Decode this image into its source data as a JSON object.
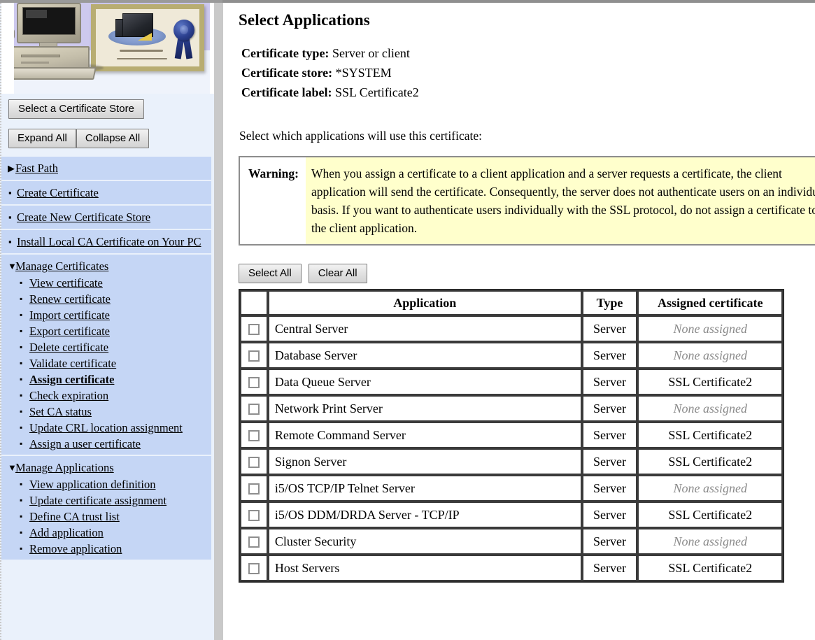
{
  "sidebar": {
    "banner_alt": "certificate-and-computer-banner",
    "store_button": "Select a Certificate Store",
    "expand_all": "Expand All",
    "collapse_all": "Collapse All",
    "nav": [
      {
        "label": "Fast Path",
        "marker": "▶",
        "bold": false,
        "children": []
      },
      {
        "label": "Create Certificate",
        "marker": "▪",
        "bold": false,
        "children": []
      },
      {
        "label": "Create New Certificate Store",
        "marker": "▪",
        "bold": false,
        "children": []
      },
      {
        "label": "Install Local CA Certificate on Your PC",
        "marker": "▪",
        "bold": false,
        "children": []
      },
      {
        "label": "Manage Certificates",
        "marker": "▼",
        "bold": false,
        "children": [
          {
            "label": "View certificate",
            "bold": false
          },
          {
            "label": "Renew certificate",
            "bold": false
          },
          {
            "label": "Import certificate",
            "bold": false
          },
          {
            "label": "Export certificate",
            "bold": false
          },
          {
            "label": "Delete certificate",
            "bold": false
          },
          {
            "label": "Validate certificate",
            "bold": false
          },
          {
            "label": "Assign certificate",
            "bold": true
          },
          {
            "label": "Check expiration",
            "bold": false
          },
          {
            "label": "Set CA status",
            "bold": false
          },
          {
            "label": "Update CRL location assignment",
            "bold": false
          },
          {
            "label": "Assign a user certificate",
            "bold": false
          }
        ]
      },
      {
        "label": "Manage Applications",
        "marker": "▼",
        "bold": false,
        "children": [
          {
            "label": "View application definition",
            "bold": false
          },
          {
            "label": "Update certificate assignment",
            "bold": false
          },
          {
            "label": "Define CA trust list",
            "bold": false
          },
          {
            "label": "Add application",
            "bold": false
          },
          {
            "label": "Remove application",
            "bold": false
          }
        ]
      }
    ]
  },
  "main": {
    "title": "Select Applications",
    "meta": [
      {
        "label": "Certificate type:",
        "value": "Server or client"
      },
      {
        "label": "Certificate store:",
        "value": "*SYSTEM"
      },
      {
        "label": "Certificate label:",
        "value": "SSL Certificate2"
      }
    ],
    "instruction": "Select which applications will use this certificate:",
    "warning": {
      "label": "Warning:",
      "text": "When you assign a certificate to a client application and a server requests a certificate, the client application will send the certificate. Consequently, the server does not authenticate users on an individual basis. If you want to authenticate users individually with the SSL protocol, do not assign a certificate to the client application.",
      "background": "#ffffcc"
    },
    "buttons": {
      "select_all": "Select All",
      "clear_all": "Clear All"
    },
    "table": {
      "headers": [
        "",
        "Application",
        "Type",
        "Assigned certificate"
      ],
      "rows": [
        {
          "checked": false,
          "application": "Central Server",
          "type": "Server",
          "certificate": "None assigned",
          "none": true
        },
        {
          "checked": false,
          "application": "Database Server",
          "type": "Server",
          "certificate": "None assigned",
          "none": true
        },
        {
          "checked": false,
          "application": "Data Queue Server",
          "type": "Server",
          "certificate": "SSL Certificate2",
          "none": false
        },
        {
          "checked": false,
          "application": "Network Print Server",
          "type": "Server",
          "certificate": "None assigned",
          "none": true
        },
        {
          "checked": false,
          "application": "Remote Command Server",
          "type": "Server",
          "certificate": "SSL Certificate2",
          "none": false
        },
        {
          "checked": false,
          "application": "Signon Server",
          "type": "Server",
          "certificate": "SSL Certificate2",
          "none": false
        },
        {
          "checked": false,
          "application": "i5/OS TCP/IP Telnet Server",
          "type": "Server",
          "certificate": "None assigned",
          "none": true
        },
        {
          "checked": false,
          "application": "i5/OS DDM/DRDA Server - TCP/IP",
          "type": "Server",
          "certificate": "SSL Certificate2",
          "none": false
        },
        {
          "checked": false,
          "application": "Cluster Security",
          "type": "Server",
          "certificate": "None assigned",
          "none": true
        },
        {
          "checked": false,
          "application": "Host Servers",
          "type": "Server",
          "certificate": "SSL Certificate2",
          "none": false
        }
      ]
    }
  }
}
